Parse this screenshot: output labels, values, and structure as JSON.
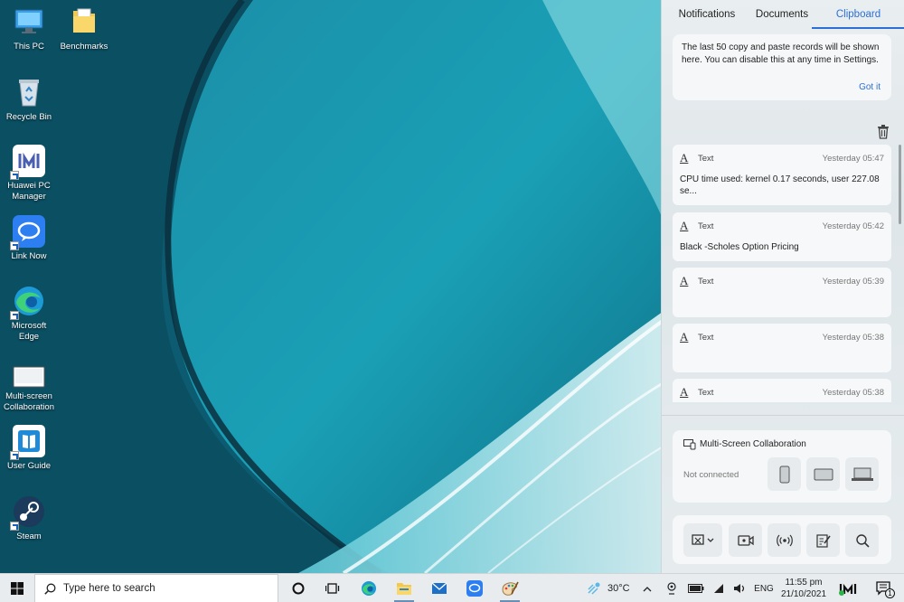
{
  "desktop": {
    "icons": [
      {
        "label": "This PC"
      },
      {
        "label": "Benchmarks"
      },
      {
        "label": "Recycle Bin"
      },
      {
        "label": "Huawei PC Manager"
      },
      {
        "label": "Link Now"
      },
      {
        "label": "Microsoft Edge"
      },
      {
        "label": "Multi-screen Collaboration"
      },
      {
        "label": "User Guide"
      },
      {
        "label": "Steam"
      }
    ]
  },
  "panel": {
    "tabs": [
      {
        "label": "Notifications"
      },
      {
        "label": "Documents"
      },
      {
        "label": "Clipboard",
        "active": true
      }
    ],
    "info_text": "The last 50 copy and paste records will be shown here. You can disable this at any time in Settings.",
    "got_it": "Got it",
    "clipboard_items": [
      {
        "type": "Text",
        "time": "Yesterday 05:47",
        "content": "CPU time used: kernel 0.17 seconds, user 227.08 se..."
      },
      {
        "type": "Text",
        "time": "Yesterday 05:42",
        "content": "Black -Scholes Option Pricing"
      },
      {
        "type": "Text",
        "time": "Yesterday 05:39",
        "content": ""
      },
      {
        "type": "Text",
        "time": "Yesterday 05:38",
        "content": ""
      },
      {
        "type": "Text",
        "time": "Yesterday 05:38",
        "content": ""
      }
    ],
    "multi_screen": {
      "title": "Multi-Screen Collaboration",
      "status": "Not connected"
    }
  },
  "taskbar": {
    "search_placeholder": "Type here to search",
    "weather": "30°C",
    "language": "ENG",
    "time": "11:55 pm",
    "date": "21/10/2021",
    "notification_count": "1"
  },
  "colors": {
    "accent": "#2d6fd6",
    "panel_bg": "#e6ecee",
    "taskbar_bg": "#e8ecef"
  }
}
